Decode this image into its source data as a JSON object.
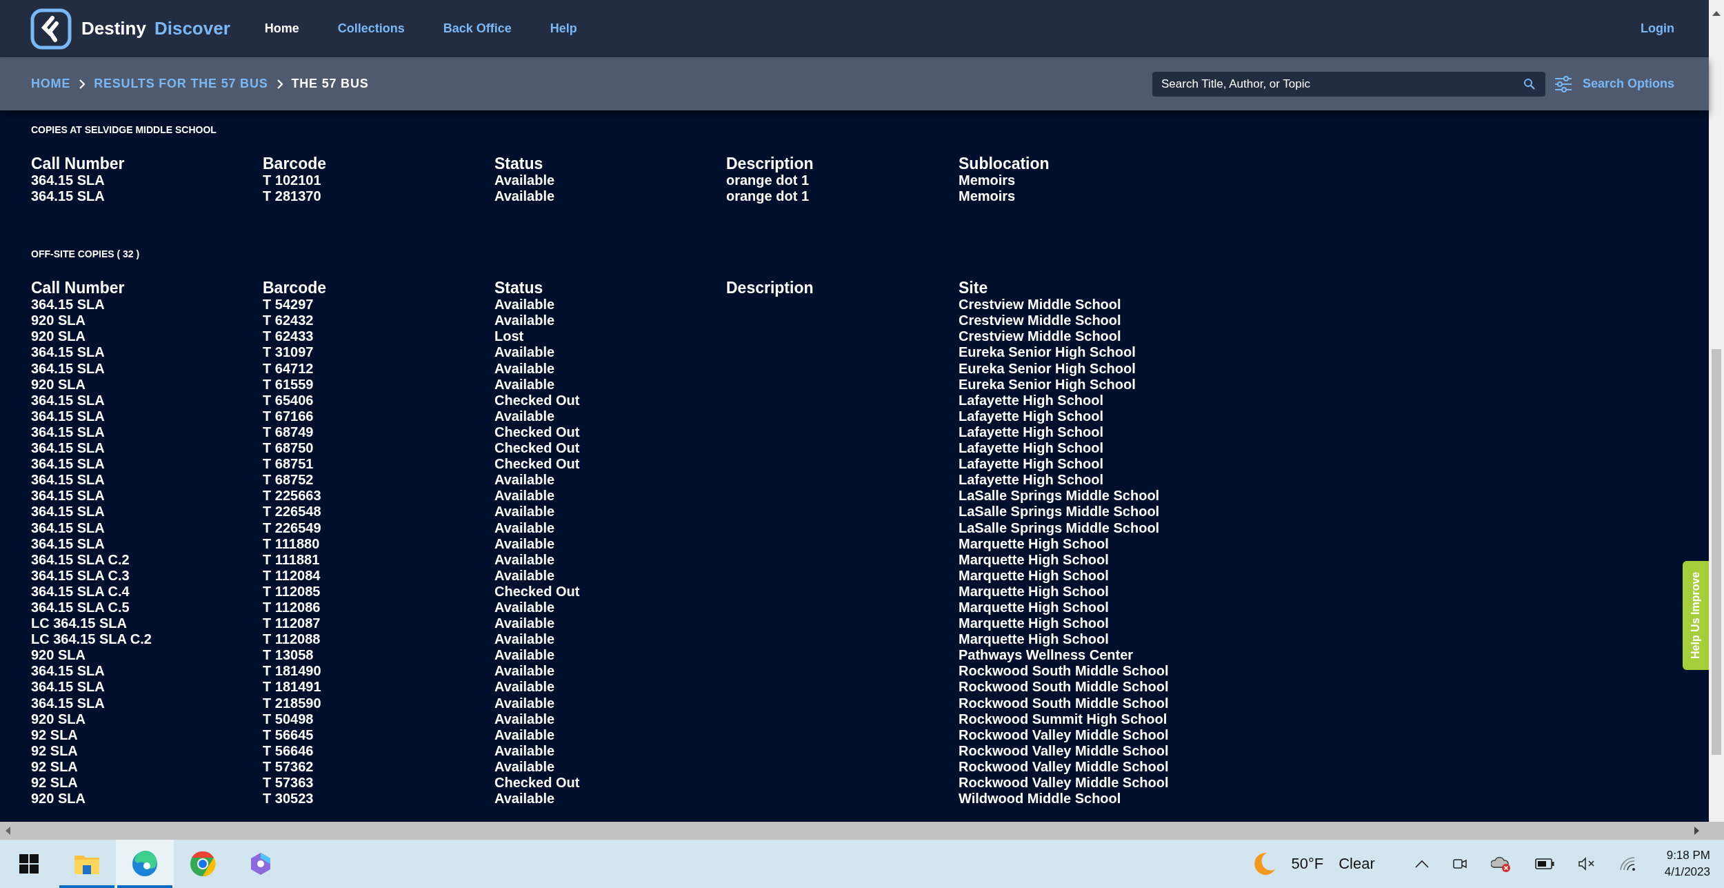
{
  "header": {
    "brand_first": "Destiny",
    "brand_second": "Discover",
    "nav": [
      {
        "label": "Home",
        "selected": true
      },
      {
        "label": "Collections",
        "selected": false
      },
      {
        "label": "Back Office",
        "selected": false
      },
      {
        "label": "Help",
        "selected": false
      }
    ],
    "login": "Login"
  },
  "breadcrumbs": [
    {
      "label": "HOME",
      "current": false
    },
    {
      "label": "RESULTS FOR THE 57 BUS",
      "current": false
    },
    {
      "label": "THE 57 BUS",
      "current": true
    }
  ],
  "search": {
    "placeholder": "Search Title, Author, or Topic",
    "options_label": "Search Options"
  },
  "local_copies": {
    "title": "COPIES AT SELVIDGE MIDDLE SCHOOL",
    "columns": [
      "Call Number",
      "Barcode",
      "Status",
      "Description",
      "Sublocation"
    ],
    "rows": [
      [
        "364.15 SLA",
        "T 102101",
        "Available",
        "orange dot 1",
        "Memoirs"
      ],
      [
        "364.15 SLA",
        "T 281370",
        "Available",
        "orange dot 1",
        "Memoirs"
      ]
    ]
  },
  "offsite_copies": {
    "title": "OFF-SITE COPIES ( 32 )",
    "columns": [
      "Call Number",
      "Barcode",
      "Status",
      "Description",
      "Site"
    ],
    "rows": [
      [
        "364.15 SLA",
        "T 54297",
        "Available",
        "",
        "Crestview Middle School"
      ],
      [
        "920 SLA",
        "T 62432",
        "Available",
        "",
        "Crestview Middle School"
      ],
      [
        "920 SLA",
        "T 62433",
        "Lost",
        "",
        "Crestview Middle School"
      ],
      [
        "364.15 SLA",
        "T 31097",
        "Available",
        "",
        "Eureka Senior High School"
      ],
      [
        "364.15 SLA",
        "T 64712",
        "Available",
        "",
        "Eureka Senior High School"
      ],
      [
        "920 SLA",
        "T 61559",
        "Available",
        "",
        "Eureka Senior High School"
      ],
      [
        "364.15 SLA",
        "T 65406",
        "Checked Out",
        "",
        "Lafayette High School"
      ],
      [
        "364.15 SLA",
        "T 67166",
        "Available",
        "",
        "Lafayette High School"
      ],
      [
        "364.15 SLA",
        "T 68749",
        "Checked Out",
        "",
        "Lafayette High School"
      ],
      [
        "364.15 SLA",
        "T 68750",
        "Checked Out",
        "",
        "Lafayette High School"
      ],
      [
        "364.15 SLA",
        "T 68751",
        "Checked Out",
        "",
        "Lafayette High School"
      ],
      [
        "364.15 SLA",
        "T 68752",
        "Available",
        "",
        "Lafayette High School"
      ],
      [
        "364.15 SLA",
        "T 225663",
        "Available",
        "",
        "LaSalle Springs Middle School"
      ],
      [
        "364.15 SLA",
        "T 226548",
        "Available",
        "",
        "LaSalle Springs Middle School"
      ],
      [
        "364.15 SLA",
        "T 226549",
        "Available",
        "",
        "LaSalle Springs Middle School"
      ],
      [
        "364.15 SLA",
        "T 111880",
        "Available",
        "",
        "Marquette High School"
      ],
      [
        "364.15 SLA C.2",
        "T 111881",
        "Available",
        "",
        "Marquette High School"
      ],
      [
        "364.15 SLA C.3",
        "T 112084",
        "Available",
        "",
        "Marquette High School"
      ],
      [
        "364.15 SLA C.4",
        "T 112085",
        "Checked Out",
        "",
        "Marquette High School"
      ],
      [
        "364.15 SLA C.5",
        "T 112086",
        "Available",
        "",
        "Marquette High School"
      ],
      [
        "LC 364.15 SLA",
        "T 112087",
        "Available",
        "",
        "Marquette High School"
      ],
      [
        "LC 364.15 SLA C.2",
        "T 112088",
        "Available",
        "",
        "Marquette High School"
      ],
      [
        "920 SLA",
        "T 13058",
        "Available",
        "",
        "Pathways Wellness Center"
      ],
      [
        "364.15 SLA",
        "T 181490",
        "Available",
        "",
        "Rockwood South Middle School"
      ],
      [
        "364.15 SLA",
        "T 181491",
        "Available",
        "",
        "Rockwood South Middle School"
      ],
      [
        "364.15 SLA",
        "T 218590",
        "Available",
        "",
        "Rockwood South Middle School"
      ],
      [
        "920 SLA",
        "T 50498",
        "Available",
        "",
        "Rockwood Summit High School"
      ],
      [
        "92 SLA",
        "T 56645",
        "Available",
        "",
        "Rockwood Valley Middle School"
      ],
      [
        "92 SLA",
        "T 56646",
        "Available",
        "",
        "Rockwood Valley Middle School"
      ],
      [
        "92 SLA",
        "T 57362",
        "Available",
        "",
        "Rockwood Valley Middle School"
      ],
      [
        "92 SLA",
        "T 57363",
        "Checked Out",
        "",
        "Rockwood Valley Middle School"
      ],
      [
        "920 SLA",
        "T 30523",
        "Available",
        "",
        "Wildwood Middle School"
      ]
    ]
  },
  "feedback_tab": "Help Us Improve",
  "taskbar": {
    "apps": [
      {
        "kind": "start",
        "running": false,
        "selected": false
      },
      {
        "kind": "files",
        "running": true,
        "selected": false
      },
      {
        "kind": "edge",
        "running": true,
        "selected": true
      },
      {
        "kind": "chrome",
        "running": false,
        "selected": false
      },
      {
        "kind": "copilot",
        "running": false,
        "selected": false
      }
    ],
    "weather": {
      "temperature": "50°F",
      "condition": "Clear"
    },
    "time": "9:18 PM",
    "date": "4/1/2023"
  }
}
